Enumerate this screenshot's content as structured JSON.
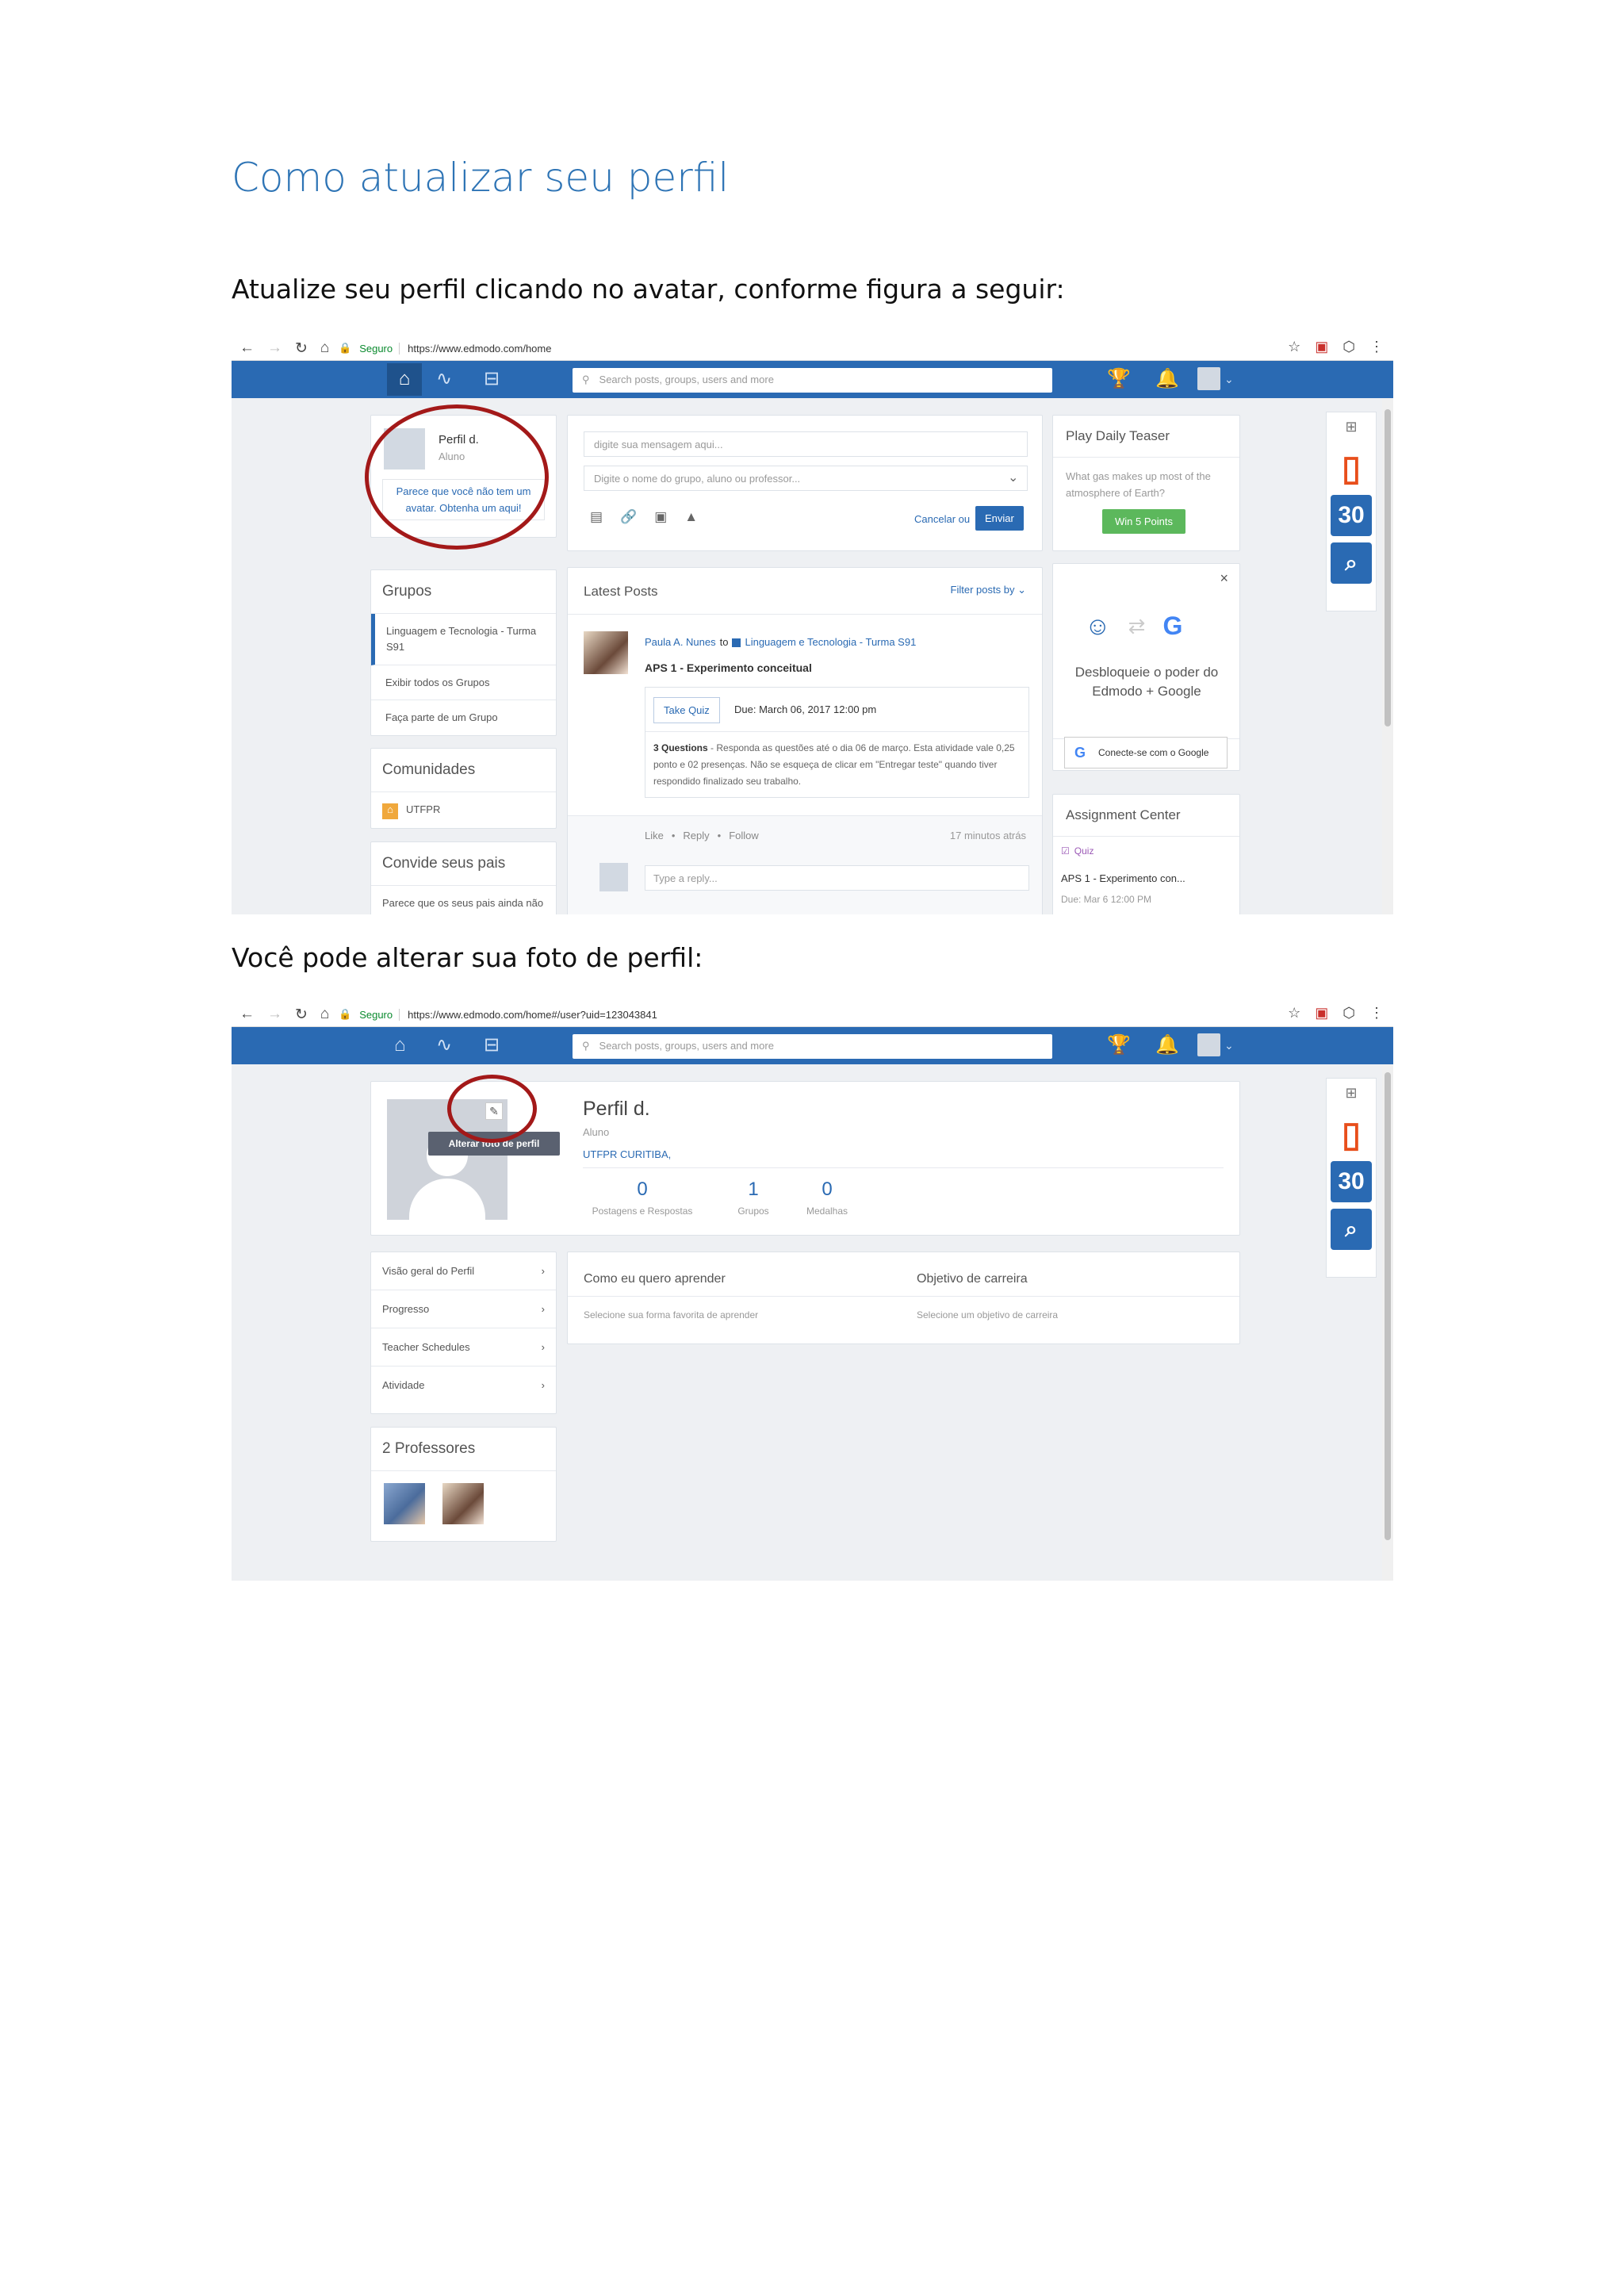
{
  "doc": {
    "title": "Como atualizar seu perfil",
    "p1": "Atualize seu perfil clicando no avatar, conforme figura a seguir:",
    "p2": "Você pode alterar sua foto de perfil:"
  },
  "shot1": {
    "browser": {
      "secure": "Seguro",
      "url": "https://www.edmodo.com/home"
    },
    "search_placeholder": "Search posts, groups, users and more",
    "profile_card": {
      "name": "Perfil d.",
      "role": "Aluno",
      "avatar_prompt": "Parece que você não tem um avatar. Obtenha um aqui!"
    },
    "composer": {
      "message_placeholder": "digite sua mensagem aqui...",
      "recipient_placeholder": "Digite o nome do grupo, aluno ou professor...",
      "cancel": "Cancelar ou",
      "send": "Enviar"
    },
    "groups": {
      "title": "Grupos",
      "group_name": "Linguagem e Tecnologia - Turma S91",
      "view_all": "Exibir todos os Grupos",
      "join": "Faça parte de um Grupo"
    },
    "communities": {
      "title": "Comunidades",
      "item": "UTFPR"
    },
    "invite": {
      "title": "Convide seus pais",
      "text": "Parece que os seus pais ainda não estão no Edmodo"
    },
    "posts": {
      "title": "Latest Posts",
      "filter": "Filter posts by",
      "author": "Paula A. Nunes",
      "to": "to",
      "group": "Linguagem e Tecnologia - Turma S91",
      "post_title": "APS 1 - Experimento conceitual",
      "take_quiz": "Take Quiz",
      "due": "Due: March 06, 2017 12:00 pm",
      "questions": "3 Questions",
      "description": " - Responda as questões até o dia 06 de março. Esta atividade vale 0,25 ponto e 02 presenças. Não se esqueça de clicar em \"Entregar teste\" quando tiver respondido finalizado seu trabalho.",
      "like": "Like",
      "reply": "Reply",
      "follow": "Follow",
      "time": "17 minutos atrás",
      "reply_placeholder": "Type a reply..."
    },
    "teaser": {
      "title": "Play Daily Teaser",
      "question": "What gas makes up most of the atmosphere of Earth?",
      "button": "Win 5 Points"
    },
    "google": {
      "text": "Desbloqueie o poder do Edmodo + Google",
      "button": "Conecte-se com o Google"
    },
    "assignments": {
      "title": "Assignment Center",
      "type": "Quiz",
      "item": "APS 1 - Experimento con...",
      "due": "Due: Mar 6 12:00 PM"
    },
    "apps": {
      "calendar_day": "30"
    }
  },
  "shot2": {
    "browser": {
      "secure": "Seguro",
      "url": "https://www.edmodo.com/home#/user?uid=123043841"
    },
    "search_placeholder": "Search posts, groups, users and more",
    "profile": {
      "name": "Perfil d.",
      "role": "Aluno",
      "school": "UTFPR CURITIBA,",
      "tooltip": "Alterar foto de perfil",
      "stats": [
        {
          "value": "0",
          "label": "Postagens e Respostas"
        },
        {
          "value": "1",
          "label": "Grupos"
        },
        {
          "value": "0",
          "label": "Medalhas"
        }
      ]
    },
    "menu": [
      "Visão geral do Perfil",
      "Progresso",
      "Teacher Schedules",
      "Atividade"
    ],
    "teachers_title": "2 Professores",
    "learning": {
      "title": "Como eu quero aprender",
      "hint": "Selecione sua forma favorita de aprender"
    },
    "career": {
      "title": "Objetivo de carreira",
      "hint": "Selecione um objetivo de carreira"
    },
    "apps": {
      "calendar_day": "30"
    }
  },
  "colors": {
    "heading": "#2E74B5",
    "edmodo_blue": "#2a6ab3",
    "highlight_circle": "#a31919",
    "green": "#5cb85c"
  }
}
